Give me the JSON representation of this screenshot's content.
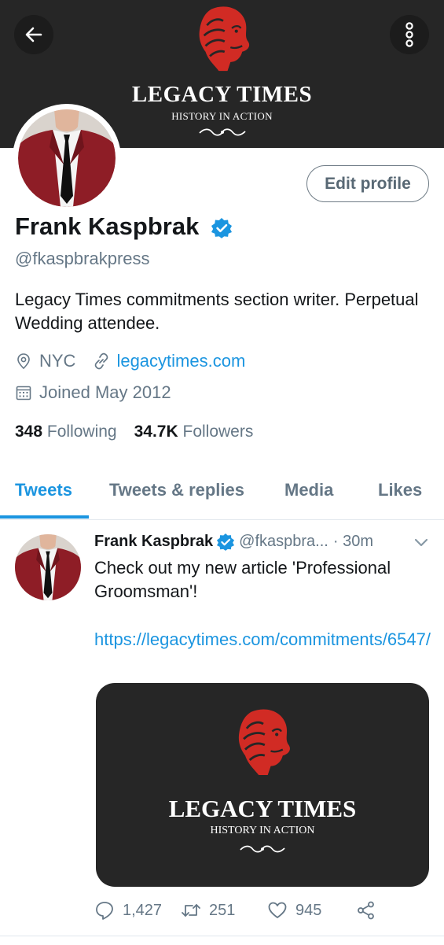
{
  "colors": {
    "accent": "#1b95e0",
    "banner_bg": "#262626",
    "logo_red": "#d12b24",
    "secondary_text": "#657786"
  },
  "header": {
    "back_icon": "arrow-left-icon",
    "more_icon": "more-vertical-icon",
    "brand_name": "LEGACY TIMES",
    "brand_tagline": "HISTORY IN ACTION"
  },
  "profile": {
    "edit_label": "Edit profile",
    "display_name": "Frank Kaspbrak",
    "handle": "@fkaspbrakpress",
    "bio": "Legacy Times commitments section writer. Perpetual Wedding attendee.",
    "location": "NYC",
    "website": "legacytimes.com",
    "joined": "Joined May 2012",
    "following_count": "348",
    "following_label": "Following",
    "followers_count": "34.7K",
    "followers_label": "Followers"
  },
  "tabs": [
    {
      "label": "Tweets",
      "active": true
    },
    {
      "label": "Tweets & replies",
      "active": false
    },
    {
      "label": "Media",
      "active": false
    },
    {
      "label": "Likes",
      "active": false
    }
  ],
  "tweet": {
    "name": "Frank Kaspbrak",
    "handle": "@fkaspbra...",
    "time": "· 30m",
    "text": "Check out my new article 'Professional Groomsman'!",
    "link": "https://legacytimes.com/commitments/6547/",
    "media": {
      "brand_name": "LEGACY TIMES",
      "brand_tagline": "HISTORY IN ACTION"
    },
    "actions": {
      "replies": "1,427",
      "retweets": "251",
      "likes": "945"
    }
  }
}
